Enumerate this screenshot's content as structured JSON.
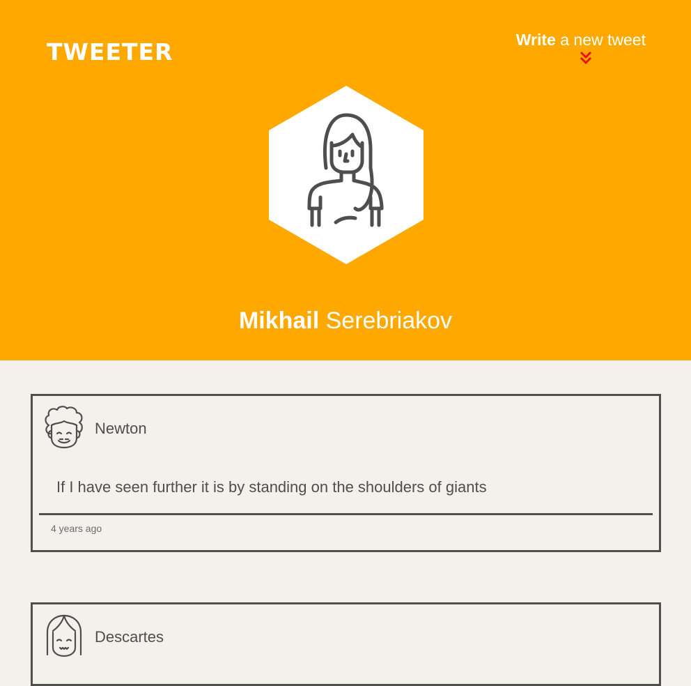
{
  "app": {
    "logo": "TWEETER"
  },
  "header": {
    "write_strong": "Write",
    "write_rest": " a new tweet",
    "write_icon": "double-chevron-down-icon",
    "accent_color": "#e8131a"
  },
  "profile": {
    "first_name": "Mikhail",
    "last_name": " Serebriakov",
    "avatar_icon": "woman-avatar-icon"
  },
  "colors": {
    "header_bg": "#ffa800",
    "page_bg": "#f4f1ec",
    "ink": "#4e4e4e"
  },
  "tweets": [
    {
      "author": "Newton",
      "avatar_icon": "curly-hair-man-avatar-icon",
      "text": "If I have seen further it is by standing on the shoulders of giants",
      "time": "4 years ago"
    },
    {
      "author": "Descartes",
      "avatar_icon": "long-hair-man-avatar-icon"
    }
  ]
}
